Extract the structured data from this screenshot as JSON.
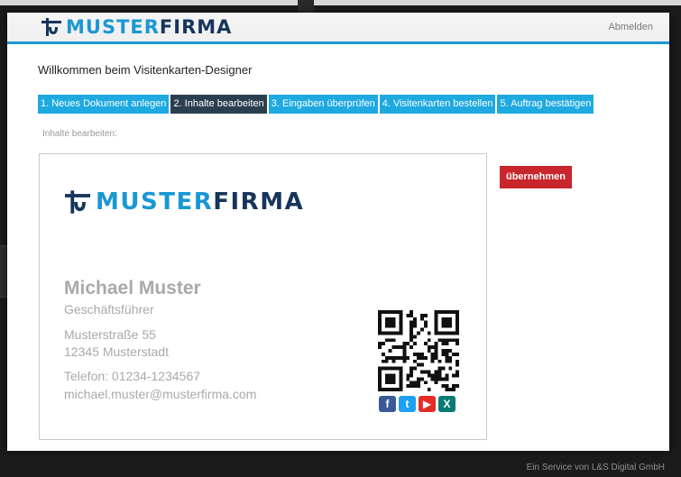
{
  "header": {
    "logo_part1": "MUSTER",
    "logo_part2": "FIRMA",
    "logout_label": "Abmelden"
  },
  "main": {
    "welcome": "Willkommen beim Visitenkarten-Designer",
    "section_label": "Inhalte bearbeiten:",
    "apply_label": "übernehmen",
    "steps": [
      {
        "label": "1. Neues Dokument anlegen",
        "active": false
      },
      {
        "label": "2. Inhalte bearbeiten",
        "active": true
      },
      {
        "label": "3. Eingaben überprüfen",
        "active": false
      },
      {
        "label": "4. Visitenkarten bestellen",
        "active": false
      },
      {
        "label": "5. Auftrag bestätigen",
        "active": false
      }
    ]
  },
  "card": {
    "logo_part1": "MUSTER",
    "logo_part2": "FIRMA",
    "name": "Michael Muster",
    "role": "Geschäftsführer",
    "street": "Musterstraße 55",
    "city": "12345 Musterstadt",
    "phone": "Telefon: 01234-1234567",
    "email": "michael.muster@musterfirma.com",
    "social_icons": [
      "facebook-icon",
      "twitter-icon",
      "youtube-icon",
      "xing-icon"
    ]
  },
  "footer": {
    "text": "Ein Service von L&S Digital GmbH"
  },
  "colors": {
    "brand_blue": "#1a97d5",
    "brand_navy": "#17355a",
    "step_blue": "#1ea9e1",
    "step_active": "#2b3e4f",
    "apply_red": "#c8252c"
  }
}
